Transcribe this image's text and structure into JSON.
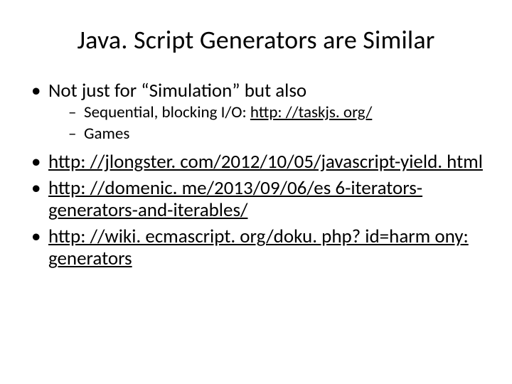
{
  "title": "Java. Script Generators are Similar",
  "bullets": {
    "b1": {
      "text": "Not just for “Simulation” but also",
      "sub": {
        "s1_prefix": "Sequential, blocking I/O: ",
        "s1_link": "http: //taskjs. org/",
        "s2": "Games"
      }
    },
    "b2": {
      "link": "http: //jlongster. com/2012/10/05/javascript-yield. html"
    },
    "b3": {
      "link": "http: //domenic. me/2013/09/06/es 6-iterators-generators-and-iterables/"
    },
    "b4": {
      "link": "http: //wiki. ecmascript. org/doku. php? id=harm ony: generators"
    }
  }
}
